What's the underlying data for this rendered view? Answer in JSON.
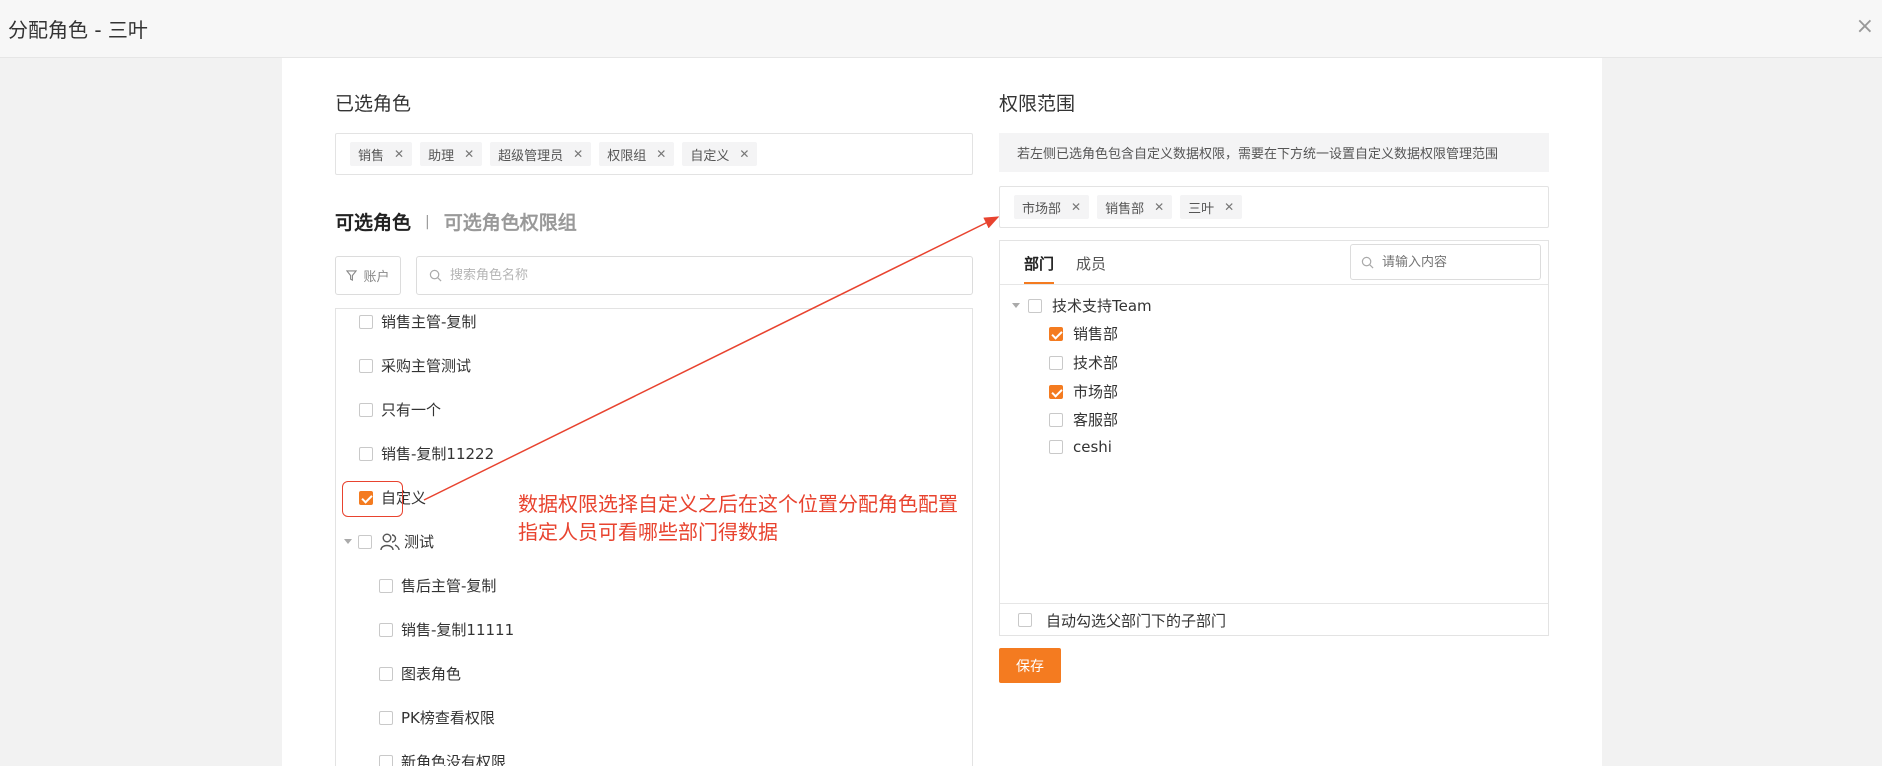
{
  "header": {
    "title": "分配角色 - 三叶",
    "close_icon": "×"
  },
  "selected_roles": {
    "title": "已选角色",
    "chips": [
      "销售",
      "助理",
      "超级管理员",
      "权限组",
      "自定义"
    ]
  },
  "role_tabs": {
    "active": "可选角色",
    "separator": "|",
    "inactive": "可选角色权限组"
  },
  "filter": {
    "label": "账户",
    "icon": "filter-icon"
  },
  "role_search": {
    "placeholder": "搜索角色名称",
    "icon": "search-icon"
  },
  "role_list": [
    {
      "label": "销售主管-复制",
      "checked": false
    },
    {
      "label": "采购主管测试",
      "checked": false
    },
    {
      "label": "只有一个",
      "checked": false
    },
    {
      "label": "销售-复制11222",
      "checked": false
    },
    {
      "label": "自定义",
      "checked": true
    },
    {
      "label": "测试",
      "checked": false,
      "group": true,
      "icon": "users-icon"
    },
    {
      "label": "售后主管-复制",
      "checked": false
    },
    {
      "label": "销售-复制11111",
      "checked": false
    },
    {
      "label": "图表角色",
      "checked": false
    },
    {
      "label": "PK榜查看权限",
      "checked": false
    },
    {
      "label": "新角色没有权限",
      "checked": false
    }
  ],
  "annotation": {
    "line1": "数据权限选择自定义之后在这个位置分配角色配置",
    "line2": "指定人员可看哪些部门得数据",
    "color": "#e8432f"
  },
  "scope": {
    "title": "权限范围",
    "info": "若左侧已选角色包含自定义数据权限，需要在下方统一设置自定义数据权限管理范围",
    "chips": [
      "市场部",
      "销售部",
      "三叶"
    ]
  },
  "dept_panel": {
    "tabs": [
      "部门",
      "成员"
    ],
    "search_placeholder": "请输入内容",
    "tree": [
      {
        "label": "技术支持Team",
        "checked": false,
        "expanded": true
      },
      {
        "label": "销售部",
        "checked": true
      },
      {
        "label": "技术部",
        "checked": false
      },
      {
        "label": "市场部",
        "checked": true
      },
      {
        "label": "客服部",
        "checked": false
      },
      {
        "label": "ceshi",
        "checked": false
      }
    ],
    "footer": {
      "label": "自动勾选父部门下的子部门",
      "checked": false
    }
  },
  "save_label": "保存",
  "colors": {
    "accent": "#f47b20",
    "annotation": "#e8432f"
  }
}
